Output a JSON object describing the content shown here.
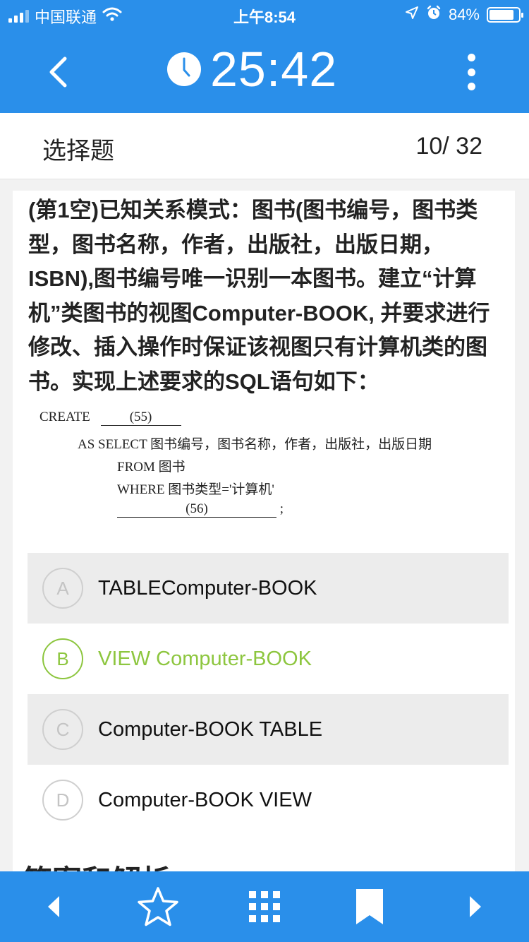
{
  "status_bar": {
    "carrier": "中国联通",
    "time": "上午8:54",
    "battery": "84%",
    "battery_level": 0.84
  },
  "nav": {
    "timer": "25:42"
  },
  "question_header": {
    "type": "选择题",
    "progress": "10/ 32"
  },
  "question": {
    "stem": "(第1空)已知关系模式：图书(图书编号，图书类型，图书名称，作者，出版社，出版日期，ISBN),图书编号唯一识别一本图书。建立“计算机”类图书的视图Computer-BOOK, 并要求进行修改、插入操作时保证该视图只有计算机类的图书。实现上述要求的SQL语句如下：",
    "sql": {
      "line1_keyword": "CREATE",
      "line1_blank": "(55)",
      "line2": "AS SELECT 图书编号，图书名称，作者，出版社，出版日期",
      "line3": "FROM 图书",
      "line4": "WHERE 图书类型='计算机'",
      "line5_blank": "(56)",
      "line5_end": ";"
    }
  },
  "options": [
    {
      "letter": "A",
      "text": "TABLEComputer-BOOK"
    },
    {
      "letter": "B",
      "text": "VIEW Computer-BOOK"
    },
    {
      "letter": "C",
      "text": "Computer-BOOK TABLE"
    },
    {
      "letter": "D",
      "text": "Computer-BOOK VIEW"
    }
  ],
  "selected_option": "B",
  "answer_section_title": "答案和解析",
  "colors": {
    "primary": "#2a8fea",
    "selected": "#8dc63f",
    "option_shaded": "#ececec"
  },
  "icons": {
    "back": "chevron-left-icon",
    "timer": "clock-icon",
    "more": "more-vertical-icon",
    "prev": "triangle-left-icon",
    "favorite": "star-icon",
    "grid": "grid-icon",
    "bookmark": "bookmark-icon",
    "next": "triangle-right-icon"
  }
}
